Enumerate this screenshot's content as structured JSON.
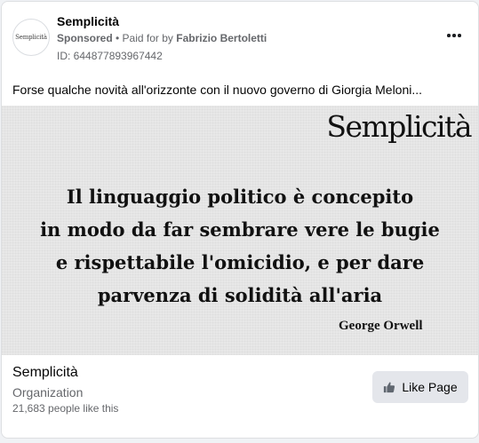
{
  "header": {
    "avatar_text": "Semplicità",
    "page_name": "Semplicità",
    "sponsored": "Sponsored",
    "separator": " • ",
    "paid_for_prefix": "Paid for by ",
    "paid_for_name": "Fabrizio Bertoletti",
    "ad_id": "ID: 644877893967442",
    "more_icon": "more-horizontal-icon"
  },
  "post": {
    "text": "Forse qualche novità all'orizzonte con il nuovo governo di Giorgia Meloni..."
  },
  "media": {
    "logo": "Semplicità",
    "quote": "Il linguaggio politico è concepito\nin modo da far sembrare vere le bugie\ne rispettabile l'omicidio, e per dare\nparvenza di solidità all'aria",
    "author": "George Orwell"
  },
  "footer": {
    "page_name": "Semplicità",
    "category": "Organization",
    "likes": "21,683 people like this",
    "like_button_label": "Like Page",
    "like_icon": "thumbs-up-icon"
  },
  "colors": {
    "background": "#f0f2f5",
    "card": "#ffffff",
    "secondary_text": "#65676b",
    "button_bg": "#e4e6eb"
  }
}
